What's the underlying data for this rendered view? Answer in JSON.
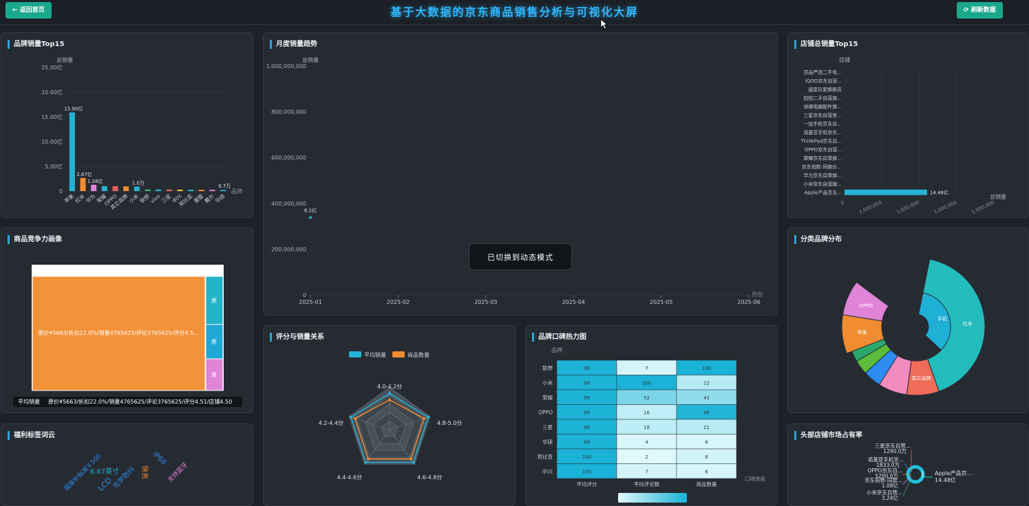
{
  "header": {
    "back_label": "返回首页",
    "title": "基于大数据的京东商品销售分析与可视化大屏",
    "refresh_label": "刷新数据"
  },
  "toast": "已切换到动态模式",
  "panels": {
    "brand_top15": "品牌销量Top15",
    "monthly_trend": "月度销量趋势",
    "shop_top15": "店铺总销量Top15",
    "competitiveness": "商品竞争力画像",
    "category_brand": "分类品牌分布",
    "welfare_cloud": "福利标签词云",
    "rating_sales": "评分与销量关系",
    "brand_heatmap": "品牌口碑热力图",
    "top_shop_share": "头部店铺市场占有率"
  },
  "chart_data": [
    {
      "id": "brand_top15",
      "type": "bar",
      "ylabel": "总销量",
      "xlabel": "品牌",
      "yticks": [
        "0",
        "5.00亿",
        "10.00亿",
        "15.00亿",
        "20.00亿",
        "25.00亿"
      ],
      "ylim": [
        0,
        25
      ],
      "categories": [
        "苹果",
        "红米",
        "华为",
        "荣耀",
        "OPPO",
        "其它品牌",
        "小米",
        "联想",
        "vivo",
        "三星",
        "中兴",
        "努比亚",
        "雷霆",
        "戴尔",
        "华硕"
      ],
      "values": [
        15.9,
        2.67,
        1.28,
        1.0,
        0.99,
        0.96,
        0.93,
        0.33,
        0.32,
        0.31,
        0.3,
        0.29,
        0.28,
        0.27,
        0.26
      ],
      "labels": [
        "15.90亿",
        "2.67亿",
        "1.28亿",
        "",
        "",
        "",
        "1.0万",
        "",
        "",
        "",
        "",
        "",
        "",
        "",
        "9.7万"
      ],
      "colors": [
        "#22b3d6",
        "#f08c32",
        "#e084d8",
        "#22b3d6",
        "#e8645a",
        "#f08c32",
        "#22b3d6",
        "#36b66a",
        "#22b3d6",
        "#e8645a",
        "#f5c34a",
        "#22b3d6",
        "#f08c32",
        "#e084d8",
        "#22b3d6"
      ]
    },
    {
      "id": "monthly_trend",
      "type": "scatter",
      "ylabel": "总销量",
      "xlabel": "月份",
      "yticks": [
        "0",
        "200,000,000",
        "400,000,000",
        "600,000,000",
        "800,000,000",
        "1,000,000,000"
      ],
      "ylim": [
        0,
        1000000000
      ],
      "x": [
        "2025-01",
        "2025-02",
        "2025-03",
        "2025-04",
        "2025-05",
        "2025-06"
      ],
      "points": [
        {
          "x": "2025-01",
          "y": 368000000,
          "label": "8.2亿"
        }
      ]
    },
    {
      "id": "shop_top15",
      "type": "bar",
      "orientation": "horizontal",
      "ylabel": "店铺",
      "xlabel": "总销量",
      "xticks": [
        "0",
        "1,000,000",
        "1,000,000",
        "1,000,000",
        "1,000,000"
      ],
      "categories": [
        "京品严选二手电...",
        "iQOO京东自营...",
        "速度玩家旗舰店",
        "拍拍二手自营旗...",
        "进顺电脑配件旗...",
        "三星京东自营官...",
        "一加手机京东自...",
        "诺基亚手机京东...",
        "ThinkPad京东自...",
        "OPPO京东自营...",
        "荣耀京东自营旗...",
        "京东指数-同款价...",
        "华为京东自营旗...",
        "小米京东自营旗...",
        "Apple产品京东..."
      ],
      "values": [
        0,
        0,
        0,
        0,
        0,
        0,
        0,
        0,
        0,
        0,
        0,
        0,
        0,
        0,
        14.48
      ],
      "value_label": "14.48亿"
    },
    {
      "id": "competitiveness",
      "type": "treemap",
      "big_label": "原价¥5663/折扣22.0%/销量4765625/评论3765625/评分4.5...",
      "small_label": "原",
      "tooltip_key": "平均销量",
      "tooltip_value": "原价¥5663/折扣22.0%/销量4765625/评论3765625/评分4.51/店铺4.50"
    },
    {
      "id": "category_brand",
      "type": "pie",
      "variant": "sunburst",
      "slices": [
        {
          "label": "手机",
          "value": 40,
          "color": "#1fb0d6"
        },
        {
          "label": "红米",
          "value": 9,
          "color": "#22bcbc"
        },
        {
          "label": "其它品牌",
          "value": 9,
          "color": "#ef6b5a"
        },
        {
          "label": "",
          "value": 8,
          "color": "#f48bbf"
        },
        {
          "label": "",
          "value": 5,
          "color": "#2d8cf0"
        },
        {
          "label": "",
          "value": 4,
          "color": "#5bbd3a"
        },
        {
          "label": "",
          "value": 3,
          "color": "#2aa86b"
        },
        {
          "label": "苹果",
          "value": 10,
          "color": "#f08c32"
        },
        {
          "label": "OPPO",
          "value": 9,
          "color": "#e084d8"
        }
      ]
    },
    {
      "id": "welfare_cloud",
      "type": "wordcloud",
      "words": [
        {
          "text": "国家补贴减￥500",
          "color": "#2d8cf0"
        },
        {
          "text": "6.67英寸",
          "color": "#22b3d6"
        },
        {
          "text": "LCD",
          "color": "#2d8cf0"
        },
        {
          "text": "光学防抖",
          "color": "#2d8cf0"
        },
        {
          "text": "快充",
          "color": "#f08c32"
        },
        {
          "text": "IP68",
          "color": "#2d8cf0"
        },
        {
          "text": "支持蓝牙",
          "color": "#e084d8"
        }
      ]
    },
    {
      "id": "rating_sales",
      "type": "radar",
      "legend": [
        "平均销量",
        "商品数量"
      ],
      "colors": [
        "#22b3d6",
        "#f08c32"
      ],
      "axes": [
        "4.0-4.2分",
        "4.8-5.0分",
        "4.6-4.8分",
        "4.4-4.6分",
        "4.2-4.4分"
      ],
      "series": [
        {
          "name": "平均销量",
          "values": [
            0.85,
            0.95,
            0.95,
            0.95,
            0.95
          ]
        },
        {
          "name": "商品数量",
          "values": [
            0.7,
            0.85,
            0.85,
            0.85,
            0.85
          ]
        }
      ]
    },
    {
      "id": "brand_heatmap",
      "type": "heatmap",
      "ylabel": "品牌",
      "xlabel": "口碑维度",
      "columns": [
        "平均评分",
        "平均评论数",
        "商品数量"
      ],
      "rows": [
        "联想",
        "小米",
        "荣耀",
        "OPPO",
        "三星",
        "华硕",
        "努比亚",
        "中兴"
      ],
      "values": [
        [
          99,
          7,
          100
        ],
        [
          99,
          100,
          22
        ],
        [
          99,
          52,
          41
        ],
        [
          99,
          16,
          96
        ],
        [
          99,
          18,
          21
        ],
        [
          99,
          4,
          6
        ],
        [
          100,
          2,
          8
        ],
        [
          100,
          7,
          6
        ]
      ]
    },
    {
      "id": "top_shop_share",
      "type": "pie",
      "variant": "donut",
      "slices": [
        {
          "label": "Apple产品京...",
          "value_label": "14.48亿",
          "value": 14.48,
          "color": "#22c3e0"
        },
        {
          "label": "三星京东自营...",
          "value_label": "1290.0万",
          "value": 0.129,
          "color": "#e8645a"
        },
        {
          "label": "诺基亚手机京...",
          "value_label": "1833.0万",
          "value": 0.1833,
          "color": "#2d8cf0"
        },
        {
          "label": "OPPO京东自...",
          "value_label": "5290.0万",
          "value": 0.529,
          "color": "#f08c32"
        },
        {
          "label": "京东指数-同款...",
          "value_label": "1.08亿",
          "value": 1.08,
          "color": "#e084d8"
        },
        {
          "label": "小米京东自营...",
          "value_label": "3.24亿",
          "value": 3.24,
          "color": "#2aa86b"
        }
      ]
    }
  ]
}
